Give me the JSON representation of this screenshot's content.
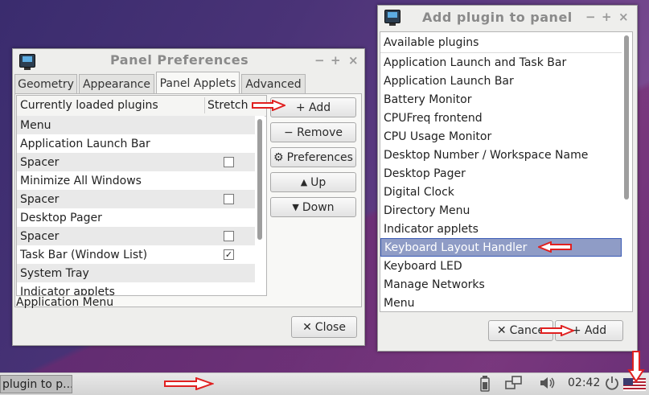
{
  "panel_prefs": {
    "title": "Panel Preferences",
    "tabs": [
      "Geometry",
      "Appearance",
      "Panel Applets",
      "Advanced"
    ],
    "list_header": {
      "col1": "Currently loaded plugins",
      "col2": "Stretch"
    },
    "plugins": [
      {
        "name": "Menu",
        "checkbox": false,
        "checked": false
      },
      {
        "name": "Application Launch Bar",
        "checkbox": false,
        "checked": false
      },
      {
        "name": "Spacer",
        "checkbox": true,
        "checked": false
      },
      {
        "name": "Minimize All Windows",
        "checkbox": false,
        "checked": false
      },
      {
        "name": "Spacer",
        "checkbox": true,
        "checked": false
      },
      {
        "name": "Desktop Pager",
        "checkbox": false,
        "checked": false
      },
      {
        "name": "Spacer",
        "checkbox": true,
        "checked": false
      },
      {
        "name": "Task Bar (Window List)",
        "checkbox": true,
        "checked": true
      },
      {
        "name": "System Tray",
        "checkbox": false,
        "checked": false
      },
      {
        "name": "Indicator applets",
        "checkbox": false,
        "checked": false
      }
    ],
    "buttons": {
      "add": "+ Add",
      "remove": "− Remove",
      "preferences": "Preferences",
      "up": "Up",
      "down": "Down",
      "close": "Close"
    },
    "status_text": "Application Menu"
  },
  "add_plugin": {
    "title": "Add plugin to panel",
    "header": "Available plugins",
    "items": [
      "Application Launch and Task Bar",
      "Application Launch Bar",
      "Battery Monitor",
      "CPUFreq frontend",
      "CPU Usage Monitor",
      "Desktop Number / Workspace Name",
      "Desktop Pager",
      "Digital Clock",
      "Directory Menu",
      "Indicator applets",
      "Keyboard Layout Handler",
      "Keyboard LED",
      "Manage Networks",
      "Menu"
    ],
    "selected_index": 10,
    "buttons": {
      "cancel": "Cance",
      "add": "+ Add"
    }
  },
  "taskbar": {
    "task_label": "plugin to p...",
    "clock": "02:42"
  },
  "colors": {
    "selection": "#8f9cc6",
    "arrow_red": "#e02020"
  }
}
